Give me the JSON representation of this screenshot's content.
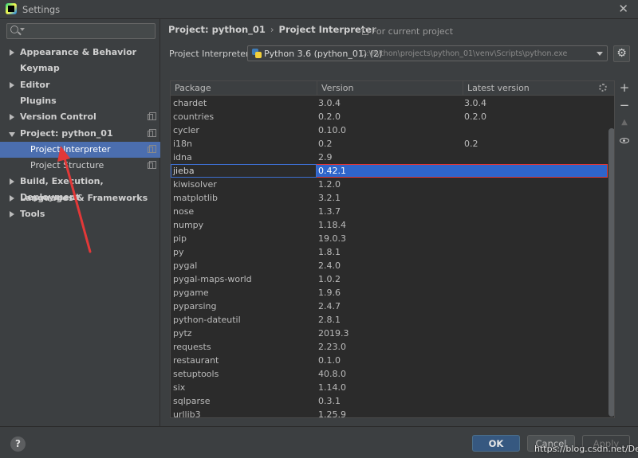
{
  "window": {
    "title": "Settings",
    "app_icon": "pycharm-icon",
    "close_icon": "close-icon"
  },
  "sidebar": {
    "search": {
      "value": "",
      "icon": "search-icon"
    },
    "items": [
      {
        "label": "Appearance & Behavior",
        "expandable": true,
        "expanded": false,
        "copy_icon": false
      },
      {
        "label": "Keymap",
        "expandable": false,
        "expanded": false,
        "copy_icon": false
      },
      {
        "label": "Editor",
        "expandable": true,
        "expanded": false,
        "copy_icon": false
      },
      {
        "label": "Plugins",
        "expandable": false,
        "expanded": false,
        "copy_icon": false
      },
      {
        "label": "Version Control",
        "expandable": true,
        "expanded": false,
        "copy_icon": true
      },
      {
        "label": "Project: python_01",
        "expandable": true,
        "expanded": true,
        "copy_icon": true
      },
      {
        "label": "Project Interpreter",
        "child": true,
        "selected": true,
        "copy_icon": true
      },
      {
        "label": "Project Structure",
        "child": true,
        "selected": false,
        "copy_icon": true
      },
      {
        "label": "Build, Execution, Deployment",
        "expandable": true,
        "expanded": false,
        "copy_icon": false
      },
      {
        "label": "Languages & Frameworks",
        "expandable": true,
        "expanded": false,
        "copy_icon": false
      },
      {
        "label": "Tools",
        "expandable": true,
        "expanded": false,
        "copy_icon": false
      }
    ]
  },
  "header": {
    "breadcrumb_project": "Project: python_01",
    "breadcrumb_separator": "›",
    "breadcrumb_page": "Project Interpreter",
    "for_current_project": "For current project"
  },
  "interpreter": {
    "label": "Project Interpreter:",
    "name": "Python 3.6 (python_01) (2)",
    "path": "D:\\Python\\projects\\python_01\\venv\\Scripts\\python.exe",
    "settings_icon": "gear-icon"
  },
  "packages_table": {
    "columns": [
      "Package",
      "Version",
      "Latest version"
    ],
    "rows": [
      {
        "package": "chardet",
        "version": "3.0.4",
        "latest": "3.0.4"
      },
      {
        "package": "countries",
        "version": "0.2.0",
        "latest": "0.2.0"
      },
      {
        "package": "cycler",
        "version": "0.10.0",
        "latest": ""
      },
      {
        "package": "i18n",
        "version": "0.2",
        "latest": "0.2"
      },
      {
        "package": "idna",
        "version": "2.9",
        "latest": ""
      },
      {
        "package": "jieba",
        "version": "0.42.1",
        "latest": "",
        "selected": true
      },
      {
        "package": "kiwisolver",
        "version": "1.2.0",
        "latest": ""
      },
      {
        "package": "matplotlib",
        "version": "3.2.1",
        "latest": ""
      },
      {
        "package": "nose",
        "version": "1.3.7",
        "latest": ""
      },
      {
        "package": "numpy",
        "version": "1.18.4",
        "latest": ""
      },
      {
        "package": "pip",
        "version": "19.0.3",
        "latest": ""
      },
      {
        "package": "py",
        "version": "1.8.1",
        "latest": ""
      },
      {
        "package": "pygal",
        "version": "2.4.0",
        "latest": ""
      },
      {
        "package": "pygal-maps-world",
        "version": "1.0.2",
        "latest": ""
      },
      {
        "package": "pygame",
        "version": "1.9.6",
        "latest": ""
      },
      {
        "package": "pyparsing",
        "version": "2.4.7",
        "latest": ""
      },
      {
        "package": "python-dateutil",
        "version": "2.8.1",
        "latest": ""
      },
      {
        "package": "pytz",
        "version": "2019.3",
        "latest": ""
      },
      {
        "package": "requests",
        "version": "2.23.0",
        "latest": ""
      },
      {
        "package": "restaurant",
        "version": "0.1.0",
        "latest": ""
      },
      {
        "package": "setuptools",
        "version": "40.8.0",
        "latest": ""
      },
      {
        "package": "six",
        "version": "1.14.0",
        "latest": ""
      },
      {
        "package": "sqlparse",
        "version": "0.3.1",
        "latest": ""
      },
      {
        "package": "urllib3",
        "version": "1.25.9",
        "latest": ""
      }
    ],
    "tools": {
      "add": "+",
      "remove": "−",
      "upgrade": "▲"
    }
  },
  "footer": {
    "help": "?",
    "ok": "OK",
    "cancel": "Cancel",
    "apply": "Apply",
    "watermark": "https://blog.csdn.net/Desiy"
  },
  "colors": {
    "selection": "#4b6eaf",
    "row_selection": "#2f65ca",
    "annotation_red": "#e23838"
  }
}
